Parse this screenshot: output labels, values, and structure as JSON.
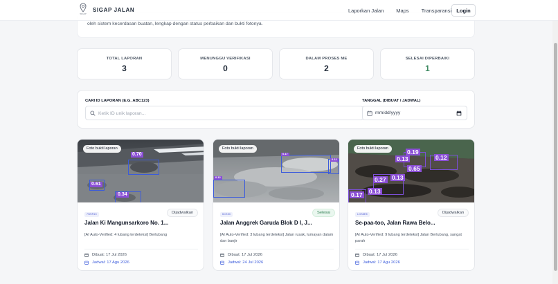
{
  "header": {
    "brand_name": "SIGAP JALAN",
    "logo_small_text": "SIGAP",
    "nav": [
      "Laporkan Jalan",
      "Maps",
      "Transparansi"
    ],
    "login_label": "Login"
  },
  "intro": {
    "text": "oleh sistem kecerdasan buatan, lengkap dengan status perbaikan dan bukti fotonya."
  },
  "stats": [
    {
      "label": "TOTAL LAPORAN",
      "value": "3"
    },
    {
      "label": "MENUNGGU VERIFIKASI",
      "value": "0"
    },
    {
      "label": "DALAM PROSES ME",
      "value": "2"
    },
    {
      "label": "SELESAI DIPERBAIKI",
      "value": "1",
      "color": "#3f8a62"
    }
  ],
  "search": {
    "label": "CARI ID LAPORAN (E.G. ABC123)",
    "placeholder": "Ketik ID unik laporan...",
    "value": ""
  },
  "date_filter": {
    "label": "TANGGAL (DIBUAT / JADWAL)",
    "value": "mm/dd/yyyy"
  },
  "reports": [
    {
      "photo_tag": "Foto bukti laporan",
      "detections": [
        "0.70",
        "0.61",
        "0.34"
      ],
      "id": "7NSR15",
      "status": "Dijadwalkan",
      "title": "Jalan Ki Mangunsarkoro No. 1...",
      "description": "[AI Auto-Verified: 4 lubang terdeteksi] Berlubang",
      "created": "Dibuat: 17 Jul 2026",
      "scheduled": "Jadwal: 17 Agu 2026"
    },
    {
      "photo_tag": "Foto bukti laporan",
      "detections": [
        "0.17",
        "0.12",
        "0.12"
      ],
      "id": "6CE83",
      "status": "Selesai",
      "title": "Jalan Anggrek Garuda Blok D I, J...",
      "description": "[AI Auto-Verified: 3 lubang terdeteksi] Jalan rusak, lumayan dalam dan banjir",
      "created": "Dibuat: 17 Jul 2026",
      "scheduled": "Jadwal: 24 Jul 2026"
    },
    {
      "photo_tag": "Foto bukti laporan",
      "detections": [
        "0.19",
        "0.13",
        "0.12",
        "0.65",
        "0.27",
        "0.13",
        "0.13",
        "0.17"
      ],
      "id": "LGS8E5",
      "status": "Dijadwalkan",
      "title": "Se-paa-too, Jalan Rawa Belo...",
      "description": "[AI Auto-Verified: 9 lubang terdeteksi] Jalan Berlubang, sangat parah",
      "created": "Dibuat: 17 Jul 2026",
      "scheduled": "Jadwal: 17 Agu 2026"
    }
  ],
  "colors": {
    "accent": "#3b5bdb",
    "detection": "#8b4fd6",
    "done": "#3f8a62"
  }
}
